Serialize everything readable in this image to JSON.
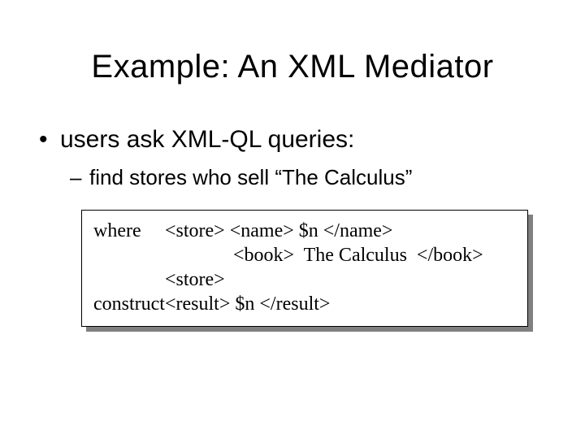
{
  "slide": {
    "title": "Example: An XML Mediator",
    "bullet1": "users ask XML-QL queries:",
    "bullet2": "find stores who sell “The Calculus”",
    "code": {
      "kw_where": "where",
      "kw_construct": "construct",
      "line1": "<store> <name> $n </name>",
      "line2": "              <book>  The Calculus  </book>",
      "line3": "<store>",
      "line4": "<result> $n </result>"
    }
  }
}
